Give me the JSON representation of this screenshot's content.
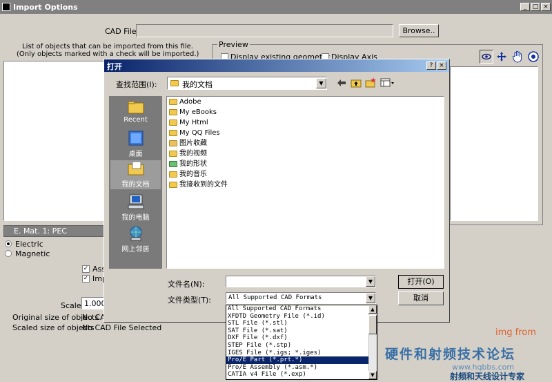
{
  "main_window": {
    "title": "Import Options",
    "min": "_",
    "max": "□",
    "close": "×",
    "cad_file_label": "CAD File",
    "browse_label": "Browse..",
    "list_caption_line1": "List of objects that can be imported from this file.",
    "list_caption_line2": "(Only objects marked with a check will be imported.)",
    "preview_label": "Preview",
    "display_existing_label": "Display existing geometry",
    "display_axis_label": "Display Axis",
    "material_value": "E. Mat. 1: PEC",
    "electric_label": "Electric",
    "magnetic_label": "Magnetic",
    "assign_label": "Ass",
    "import_label": "Imp",
    "scale_label": "Scale",
    "scale_value": "1.000",
    "original_size_label": "Original size of objects",
    "original_size_value": "No CAD File Selected",
    "scaled_size_label": "Scaled size of objects",
    "scaled_size_value": "No CAD File Selected"
  },
  "open_dialog": {
    "title": "打开",
    "help": "?",
    "close": "×",
    "lookin_label": "查找范围(I):",
    "lookin_value": "我的文档",
    "places": [
      "Recent",
      "桌面",
      "我的文档",
      "我的电脑",
      "网上邻居"
    ],
    "files": [
      "Adobe",
      "My eBooks",
      "My Html",
      "My QQ Files",
      "图片收藏",
      "我的视频",
      "我的形状",
      "我的音乐",
      "我接收到的文件"
    ],
    "filename_label": "文件名(N):",
    "filename_value": "",
    "filetype_label": "文件类型(T):",
    "filetype_value": "All Supported CAD Formats",
    "open_button": "打开(O)",
    "cancel_button": "取消",
    "filetype_options": [
      "All Supported CAD Formats",
      "XFDTD Geometry File (*.id)",
      "STL File (*.stl)",
      "SAT File (*.sat)",
      "DXF File (*.dxf)",
      "STEP File (*.stp)",
      "IGES File (*.igs; *.iges)",
      "Pro/E Part (*.prt.*)",
      "Pro/E Assembly (*.asm.*)",
      "CATIA v4 File (*.exp)"
    ]
  },
  "watermark": {
    "img_from": "img from",
    "chinese": "硬件和射频技术论坛",
    "bottom": "射频和天线设计专家",
    "url": "www.hqbbs.com"
  }
}
